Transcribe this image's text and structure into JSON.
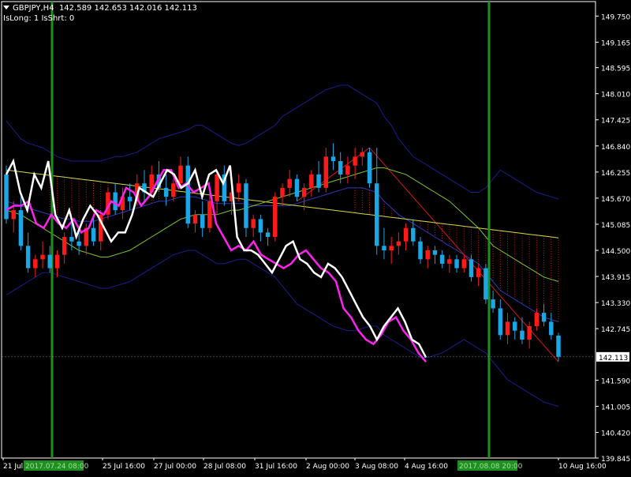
{
  "header": {
    "symbol": "GBPJPY,H4",
    "ohlc": "142.589 142.653 142.016 142.113",
    "status": "IsLong: 1 IsShrt: 0"
  },
  "colors": {
    "background": "#000000",
    "bull": "#ff1a1a",
    "bear": "#19a7e6",
    "bollinger": "#1c1c8c",
    "ma_white": "#ffffff",
    "ma_magenta": "#ff22ee",
    "ma_yellow": "#d8d84a",
    "ma_green": "#7cc42a",
    "marker": "#1f8f1f",
    "cloud": "#d01818"
  },
  "chart_data": {
    "type": "candlestick",
    "title": "",
    "xlabel": "",
    "ylabel": "",
    "ylim": [
      139.845,
      150.075
    ],
    "y_ticks": [
      "149.750",
      "149.165",
      "148.595",
      "148.010",
      "147.425",
      "146.840",
      "146.255",
      "145.670",
      "145.085",
      "144.500",
      "143.915",
      "143.330",
      "142.745",
      "142.113",
      "141.590",
      "141.005",
      "140.420",
      "139.845"
    ],
    "current_price": "142.113",
    "x_labels": [
      "21 Jul 2017",
      "25 Jul 16:00",
      "27 Jul 00:00",
      "28 Jul 08:00",
      "31 Jul 16:00",
      "2 Aug 00:00",
      "3 Aug 08:00",
      "4 Aug 16:00",
      "10 Aug 16:00"
    ],
    "x_markers": [
      "2017.07.24 08:00",
      "2017.08.08 20:00"
    ],
    "candles": [
      [
        146.2,
        146.4,
        145.1,
        145.2
      ],
      [
        145.2,
        145.6,
        144.9,
        145.4
      ],
      [
        145.4,
        145.7,
        144.5,
        144.6
      ],
      [
        144.6,
        144.9,
        144.0,
        144.1
      ],
      [
        144.1,
        144.4,
        143.9,
        144.3
      ],
      [
        144.3,
        144.7,
        144.1,
        144.4
      ],
      [
        144.4,
        144.6,
        144.0,
        144.1
      ],
      [
        144.1,
        144.5,
        143.9,
        144.4
      ],
      [
        144.4,
        144.9,
        144.2,
        144.8
      ],
      [
        144.8,
        145.2,
        144.5,
        144.7
      ],
      [
        144.7,
        145.0,
        144.4,
        144.6
      ],
      [
        144.6,
        145.1,
        144.4,
        145.0
      ],
      [
        145.0,
        145.3,
        144.6,
        144.7
      ],
      [
        144.7,
        145.4,
        144.5,
        145.3
      ],
      [
        145.3,
        145.9,
        145.2,
        145.8
      ],
      [
        145.8,
        146.0,
        145.3,
        145.4
      ],
      [
        145.4,
        145.9,
        145.2,
        145.7
      ],
      [
        145.7,
        146.0,
        145.4,
        145.6
      ],
      [
        145.6,
        146.2,
        145.5,
        146.0
      ],
      [
        146.0,
        146.3,
        145.6,
        145.8
      ],
      [
        145.8,
        146.4,
        145.7,
        146.2
      ],
      [
        146.2,
        146.5,
        145.8,
        145.9
      ],
      [
        145.9,
        146.2,
        145.5,
        145.7
      ],
      [
        145.7,
        146.1,
        145.6,
        146.0
      ],
      [
        146.0,
        146.6,
        145.9,
        146.4
      ],
      [
        146.4,
        146.6,
        145.0,
        145.1
      ],
      [
        145.1,
        145.4,
        144.9,
        145.3
      ],
      [
        145.3,
        145.6,
        144.8,
        145.0
      ],
      [
        145.0,
        145.8,
        144.9,
        145.6
      ],
      [
        145.6,
        146.3,
        145.3,
        146.2
      ],
      [
        146.2,
        146.4,
        145.5,
        145.6
      ],
      [
        145.6,
        145.9,
        145.3,
        145.8
      ],
      [
        145.8,
        146.2,
        145.6,
        146.0
      ],
      [
        146.0,
        146.1,
        144.8,
        145.0
      ],
      [
        145.0,
        145.3,
        144.8,
        145.2
      ],
      [
        145.2,
        145.3,
        144.7,
        144.9
      ],
      [
        144.9,
        145.0,
        144.6,
        144.8
      ],
      [
        144.8,
        145.8,
        144.7,
        145.7
      ],
      [
        145.7,
        146.0,
        145.5,
        145.9
      ],
      [
        145.9,
        146.3,
        145.7,
        146.1
      ],
      [
        146.1,
        146.2,
        145.6,
        145.7
      ],
      [
        145.7,
        146.0,
        145.4,
        145.9
      ],
      [
        145.9,
        146.3,
        145.7,
        146.2
      ],
      [
        146.2,
        146.5,
        145.8,
        145.9
      ],
      [
        145.9,
        146.8,
        145.8,
        146.6
      ],
      [
        146.6,
        146.9,
        146.3,
        146.5
      ],
      [
        146.5,
        146.7,
        146.0,
        146.2
      ],
      [
        146.2,
        146.6,
        146.0,
        146.4
      ],
      [
        146.4,
        146.8,
        146.1,
        146.6
      ],
      [
        146.6,
        146.8,
        146.4,
        146.7
      ],
      [
        146.7,
        146.8,
        145.9,
        146.0
      ],
      [
        146.0,
        146.8,
        144.4,
        144.6
      ],
      [
        144.6,
        145.0,
        144.3,
        144.5
      ],
      [
        144.5,
        144.8,
        144.2,
        144.6
      ],
      [
        144.6,
        144.9,
        144.4,
        144.7
      ],
      [
        144.7,
        145.1,
        144.5,
        145.0
      ],
      [
        145.0,
        145.2,
        144.6,
        144.7
      ],
      [
        144.7,
        144.8,
        144.2,
        144.3
      ],
      [
        144.3,
        144.6,
        144.1,
        144.5
      ],
      [
        144.5,
        144.6,
        144.2,
        144.4
      ],
      [
        144.4,
        144.5,
        144.1,
        144.2
      ],
      [
        144.2,
        144.4,
        144.0,
        144.3
      ],
      [
        144.3,
        144.4,
        144.0,
        144.1
      ],
      [
        144.1,
        144.4,
        144.0,
        144.3
      ],
      [
        144.3,
        144.4,
        143.8,
        143.9
      ],
      [
        143.9,
        144.2,
        143.7,
        144.1
      ],
      [
        144.1,
        144.2,
        143.3,
        143.4
      ],
      [
        143.4,
        143.6,
        143.1,
        143.2
      ],
      [
        143.2,
        143.4,
        142.5,
        142.6
      ],
      [
        142.6,
        143.1,
        142.4,
        142.9
      ],
      [
        142.9,
        143.0,
        142.5,
        142.7
      ],
      [
        142.7,
        143.0,
        142.4,
        142.5
      ],
      [
        142.5,
        142.9,
        142.3,
        142.8
      ],
      [
        142.8,
        143.2,
        142.7,
        143.1
      ],
      [
        143.1,
        143.3,
        142.8,
        142.9
      ],
      [
        142.9,
        143.1,
        142.5,
        142.6
      ],
      [
        142.589,
        142.653,
        142.016,
        142.113
      ]
    ],
    "series": [
      {
        "kind": "band",
        "values": [
          147.4,
          147.2,
          147.0,
          146.9,
          146.85,
          146.8,
          146.7,
          146.6,
          146.55,
          146.5,
          146.5,
          146.5,
          146.5,
          146.5,
          146.55,
          146.6,
          146.6,
          146.65,
          146.7,
          146.8,
          146.9,
          147.0,
          147.05,
          147.1,
          147.15,
          147.2,
          147.3,
          147.3,
          147.2,
          147.1,
          147.0,
          146.9,
          146.85,
          146.9,
          147.0,
          147.1,
          147.2,
          147.3,
          147.5,
          147.6,
          147.7,
          147.8,
          147.9,
          148.0,
          148.1,
          148.15,
          148.2,
          148.2,
          148.1,
          148.0,
          147.9,
          147.8,
          147.5,
          147.3,
          147.0,
          146.8,
          146.6,
          146.5,
          146.4,
          146.3,
          146.2,
          146.1,
          146.0,
          145.9,
          145.8,
          145.8,
          145.9,
          146.1,
          146.3,
          146.2,
          146.1,
          146.0,
          145.9,
          145.8,
          145.75,
          145.7,
          145.65
        ]
      },
      {
        "kind": "band",
        "values": [
          143.5,
          143.6,
          143.7,
          143.8,
          143.9,
          144.0,
          144.0,
          143.95,
          143.9,
          143.85,
          143.8,
          143.75,
          143.7,
          143.65,
          143.65,
          143.7,
          143.75,
          143.8,
          143.9,
          144.0,
          144.1,
          144.2,
          144.3,
          144.4,
          144.45,
          144.5,
          144.5,
          144.4,
          144.3,
          144.2,
          144.2,
          144.25,
          144.3,
          144.3,
          144.2,
          144.1,
          144.0,
          143.9,
          143.7,
          143.5,
          143.3,
          143.2,
          143.1,
          143.0,
          142.9,
          142.8,
          142.75,
          142.7,
          142.7,
          142.75,
          142.8,
          142.8,
          142.6,
          142.5,
          142.4,
          142.3,
          142.2,
          142.1,
          142.1,
          142.15,
          142.2,
          142.3,
          142.4,
          142.5,
          142.4,
          142.3,
          142.2,
          142.0,
          141.8,
          141.6,
          141.5,
          141.4,
          141.3,
          141.2,
          141.1,
          141.05,
          141.0
        ]
      },
      {
        "kind": "band",
        "values": [
          145.6,
          145.55,
          145.5,
          145.45,
          145.4,
          145.35,
          145.3,
          145.25,
          145.2,
          145.2,
          145.15,
          145.15,
          145.15,
          145.2,
          145.25,
          145.3,
          145.35,
          145.4,
          145.45,
          145.5,
          145.55,
          145.6,
          145.6,
          145.65,
          145.7,
          145.7,
          145.7,
          145.65,
          145.6,
          145.55,
          145.55,
          145.55,
          145.55,
          145.55,
          145.5,
          145.5,
          145.5,
          145.5,
          145.5,
          145.5,
          145.55,
          145.6,
          145.65,
          145.7,
          145.75,
          145.8,
          145.85,
          145.9,
          145.9,
          145.9,
          145.85,
          145.8,
          145.6,
          145.45,
          145.3,
          145.2,
          145.1,
          145.0,
          144.9,
          144.8,
          144.7,
          144.6,
          144.5,
          144.4,
          144.3,
          144.2,
          144.0,
          143.8,
          143.6,
          143.5,
          143.4,
          143.3,
          143.2,
          143.1,
          143.0,
          142.95,
          142.9
        ]
      },
      {
        "kind": "ma_white",
        "values": [
          146.2,
          146.5,
          145.8,
          145.4,
          146.2,
          145.9,
          146.5,
          145.3,
          145.0,
          145.4,
          144.8,
          145.2,
          145.5,
          145.3,
          145.0,
          144.7,
          144.9,
          144.9,
          145.3,
          145.9,
          145.8,
          145.7,
          146.0,
          146.3,
          146.2,
          145.9,
          146.0,
          146.3,
          145.7,
          146.2,
          146.3,
          146.0,
          146.4,
          144.8,
          144.5,
          144.5,
          144.4,
          144.2,
          144.0,
          144.3,
          144.6,
          144.7,
          144.3,
          144.2,
          144.0,
          143.9,
          144.2,
          144.1,
          143.9,
          143.6,
          143.3,
          143.0,
          142.8,
          142.5,
          142.8,
          143.0,
          143.2,
          142.9,
          142.5,
          142.4,
          142.1
        ]
      },
      {
        "kind": "ma_magenta",
        "values": [
          145.4,
          145.5,
          145.5,
          145.6,
          145.1,
          145.0,
          145.3,
          145.1,
          145.0,
          145.2,
          144.9,
          145.0,
          145.4,
          145.3,
          145.6,
          145.5,
          145.9,
          145.8,
          145.5,
          145.7,
          146.0,
          146.3,
          146.3,
          145.9,
          146.0,
          145.8,
          145.9,
          146.0,
          145.1,
          144.8,
          144.5,
          144.6,
          144.5,
          144.7,
          144.4,
          144.3,
          144.2,
          144.1,
          144.2,
          144.4,
          144.5,
          144.3,
          144.1,
          144.0,
          143.8,
          143.2,
          143.0,
          142.7,
          142.5,
          142.4,
          142.6,
          142.9,
          143.0,
          142.7,
          142.5,
          142.2,
          142.0
        ]
      },
      {
        "kind": "ma_yellow",
        "values": [
          146.3,
          146.28,
          146.26,
          146.24,
          146.22,
          146.2,
          146.18,
          146.16,
          146.14,
          146.12,
          146.1,
          146.08,
          146.06,
          146.04,
          146.02,
          146.0,
          145.98,
          145.96,
          145.94,
          145.92,
          145.9,
          145.88,
          145.86,
          145.84,
          145.82,
          145.8,
          145.78,
          145.76,
          145.74,
          145.72,
          145.7,
          145.68,
          145.66,
          145.64,
          145.62,
          145.6,
          145.58,
          145.56,
          145.54,
          145.52,
          145.5,
          145.48,
          145.46,
          145.44,
          145.42,
          145.4,
          145.38,
          145.36,
          145.34,
          145.32,
          145.3,
          145.28,
          145.26,
          145.24,
          145.22,
          145.2,
          145.18,
          145.16,
          145.14,
          145.12,
          145.1,
          145.08,
          145.06,
          145.04,
          145.02,
          145.0,
          144.98,
          144.96,
          144.94,
          144.92,
          144.9,
          144.88,
          144.86,
          144.84,
          144.82,
          144.8,
          144.78
        ]
      },
      {
        "kind": "ma_green",
        "values": [
          145.4,
          145.35,
          145.3,
          145.2,
          145.1,
          145.0,
          144.9,
          144.8,
          144.7,
          144.6,
          144.5,
          144.45,
          144.4,
          144.35,
          144.35,
          144.4,
          144.45,
          144.5,
          144.6,
          144.7,
          144.8,
          144.9,
          145.0,
          145.1,
          145.2,
          145.25,
          145.3,
          145.3,
          145.3,
          145.3,
          145.35,
          145.4,
          145.4,
          145.45,
          145.5,
          145.55,
          145.6,
          145.65,
          145.7,
          145.75,
          145.8,
          145.85,
          145.9,
          145.95,
          146.0,
          146.05,
          146.1,
          146.15,
          146.2,
          146.25,
          146.3,
          146.35,
          146.35,
          146.3,
          146.25,
          146.2,
          146.1,
          146.0,
          145.9,
          145.8,
          145.7,
          145.6,
          145.45,
          145.3,
          145.15,
          145.0,
          144.8,
          144.6,
          144.5,
          144.4,
          144.3,
          144.2,
          144.1,
          144.0,
          143.9,
          143.85,
          143.8
        ]
      }
    ]
  }
}
